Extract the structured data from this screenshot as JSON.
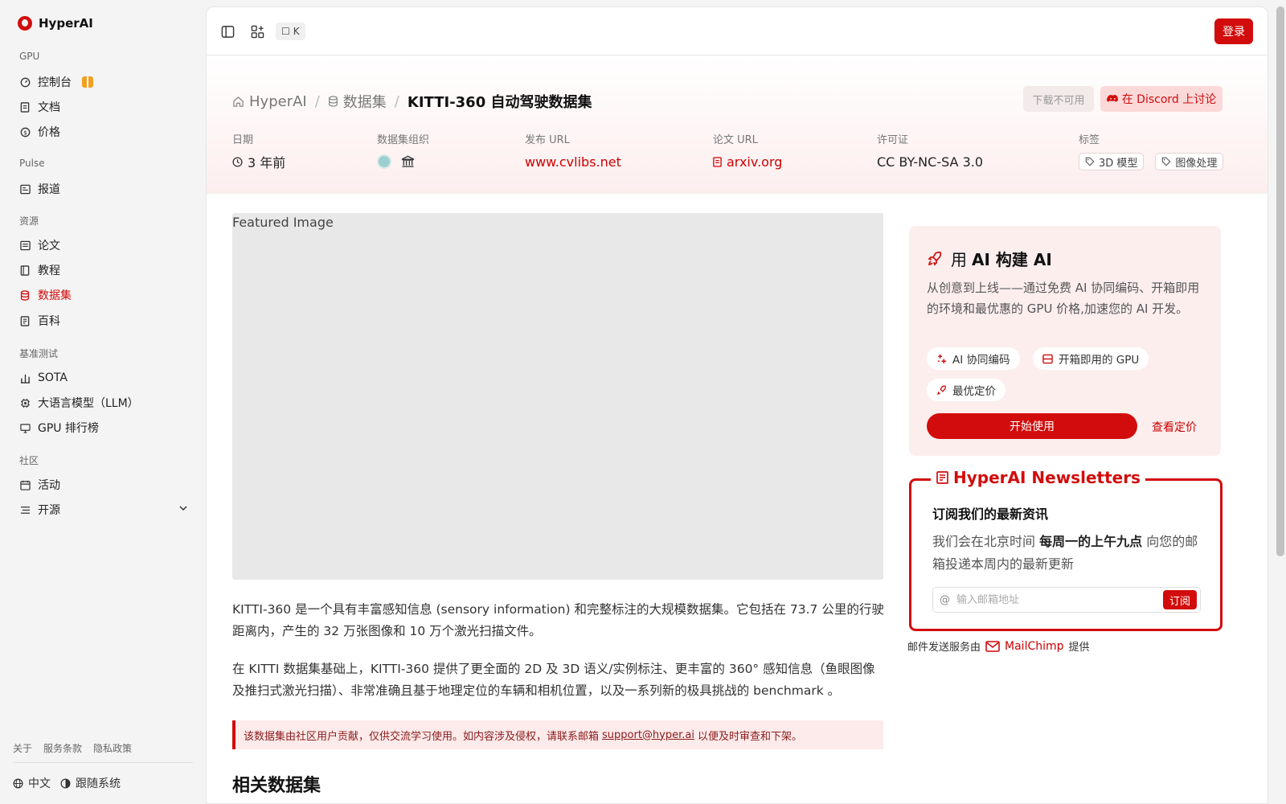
{
  "brand": {
    "name": "HyperAI",
    "color": "#d20c0c"
  },
  "sidebar": {
    "sections": [
      {
        "label": "GPU",
        "items": [
          {
            "label": "控制台",
            "icon": "gauge-icon"
          },
          {
            "label": "文档",
            "icon": "document-icon"
          },
          {
            "label": "价格",
            "icon": "dollar-icon"
          }
        ]
      },
      {
        "label": "Pulse",
        "items": [
          {
            "label": "报道",
            "icon": "newspaper-icon"
          }
        ]
      },
      {
        "label": "资源",
        "items": [
          {
            "label": "论文",
            "icon": "paper-icon"
          },
          {
            "label": "教程",
            "icon": "book-icon"
          },
          {
            "label": "数据集",
            "icon": "database-icon",
            "active": true
          },
          {
            "label": "百科",
            "icon": "encyclopedia-icon"
          }
        ]
      },
      {
        "label": "基准测试",
        "items": [
          {
            "label": "SOTA",
            "icon": "bar-chart-icon"
          },
          {
            "label": "大语言模型（LLM）",
            "icon": "chip-icon"
          },
          {
            "label": "GPU 排行榜",
            "icon": "monitor-icon"
          }
        ]
      },
      {
        "label": "社区",
        "items": [
          {
            "label": "活动",
            "icon": "calendar-icon"
          },
          {
            "label": "开源",
            "icon": "list-icon"
          }
        ]
      }
    ],
    "footer_links": [
      "关于",
      "服务条款",
      "隐私政策"
    ],
    "language": "中文",
    "theme": "跟随系统"
  },
  "topbar": {
    "shortcut": "K",
    "login": "登录"
  },
  "breadcrumb": {
    "home": "HyperAI",
    "section": "数据集",
    "current": "KITTI-360 自动驾驶数据集"
  },
  "actions": {
    "download": "下载不可用",
    "discord": "在 Discord 上讨论"
  },
  "meta": {
    "date_label": "日期",
    "date_value": "3 年前",
    "org_label": "数据集组织",
    "publish_label": "发布 URL",
    "publish_value": "www.cvlibs.net",
    "paper_label": "论文 URL",
    "paper_value": "arxiv.org",
    "license_label": "许可证",
    "license_value": "CC BY-NC-SA 3.0",
    "tags_label": "标签",
    "tags": [
      "3D 模型",
      "图像处理"
    ]
  },
  "featured_alt": "Featured Image",
  "description": [
    "KITTI-360 是一个具有丰富感知信息 (sensory information) 和完整标注的大规模数据集。它包括在 73.7 公里的行驶距离内，产生的 32 万张图像和 10 万个激光扫描文件。",
    "在 KITTI 数据集基础上，KITTI-360 提供了更全面的 2D 及 3D 语义/实例标注、更丰富的 360° 感知信息（鱼眼图像及推扫式激光扫描）、非常准确且基于地理定位的车辆和相机位置，以及一系列新的极具挑战的 benchmark 。"
  ],
  "notice": {
    "before": "该数据集由社区用户贡献，仅供交流学习使用。如内容涉及侵权，请联系邮箱",
    "email": "support@hyper.ai",
    "after": "以便及时审查和下架。"
  },
  "related_title": "相关数据集",
  "promo": {
    "title_prefix": "用",
    "title_bold": "AI 构建 AI",
    "desc": "从创意到上线——通过免费 AI 协同编码、开箱即用的环境和最优惠的 GPU 价格,加速您的 AI 开发。",
    "features": [
      "AI 协同编码",
      "开箱即用的 GPU",
      "最优定价"
    ],
    "start": "开始使用",
    "pricing": "查看定价"
  },
  "newsletter": {
    "title": "HyperAI Newsletters",
    "subtitle": "订阅我们的最新资讯",
    "desc_before": "我们会在北京时间 ",
    "desc_bold": "每周一的上午九点",
    "desc_after": " 向您的邮箱投递本周内的最新更新",
    "placeholder": "输入邮箱地址",
    "subscribe": "订阅",
    "provider_before": "邮件发送服务由",
    "provider_name": "MailChimp",
    "provider_after": "提供"
  }
}
